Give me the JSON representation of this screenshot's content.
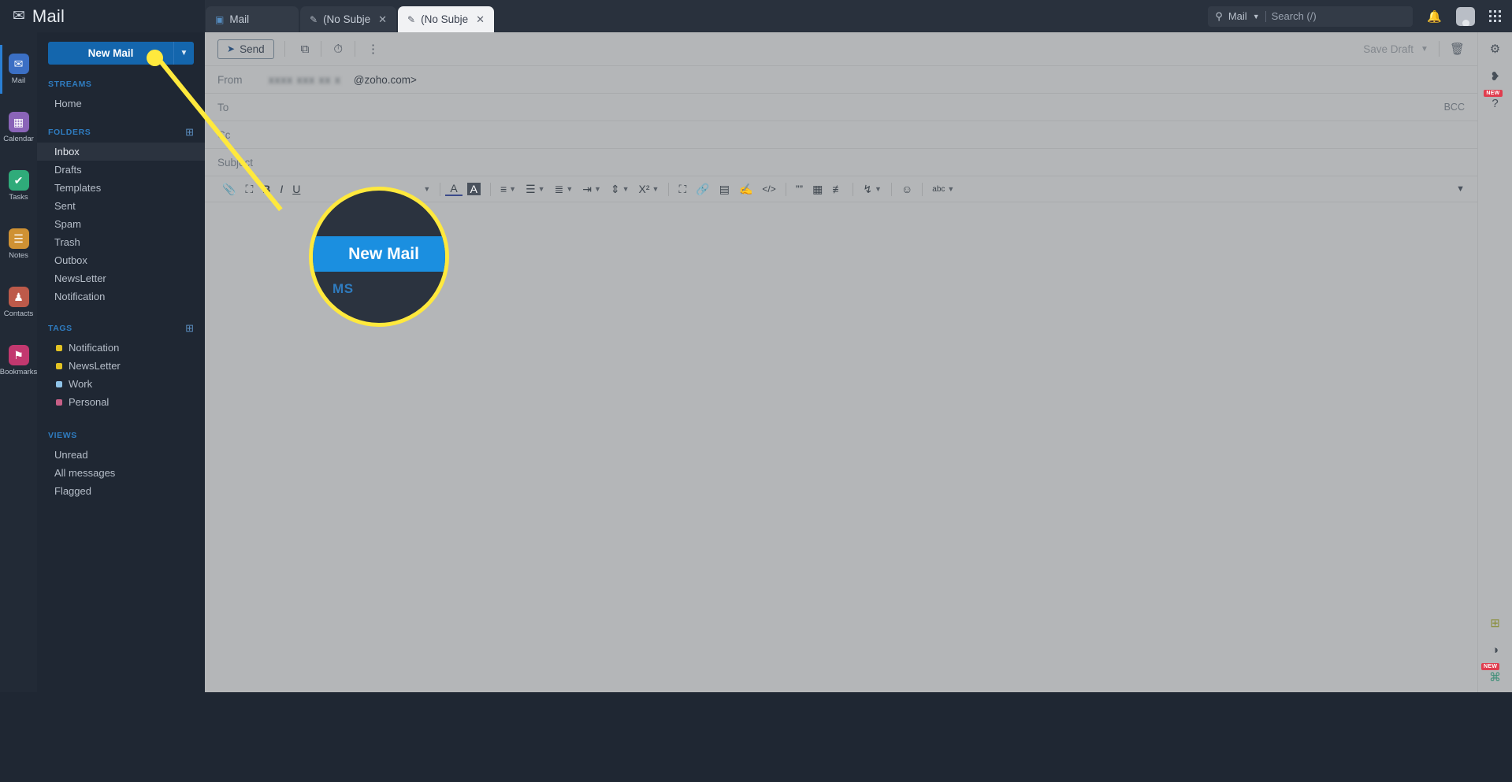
{
  "brand": {
    "label": "Mail",
    "icon": "envelope-icon"
  },
  "tabs": [
    {
      "label": "Mail",
      "icon": "mail-tab-icon",
      "active": false,
      "closable": false
    },
    {
      "label": "(No Subje",
      "icon": "pencil-icon",
      "active": false,
      "closable": true
    },
    {
      "label": "(No Subje",
      "icon": "pencil-icon",
      "active": true,
      "closable": true
    }
  ],
  "topright": {
    "search_scope": "Mail",
    "search_placeholder": "Search (/)",
    "search_icon": "search-icon",
    "chevron_icon": "chevron-down-icon",
    "bell_icon": "bell-icon",
    "avatar_icon": "avatar",
    "apps_icon": "grid-apps-icon"
  },
  "rail": [
    {
      "label": "Mail",
      "icon": "mail-icon",
      "color": "#3b6fc4",
      "glyph": "✉",
      "selected": true
    },
    {
      "label": "Calendar",
      "icon": "calendar-icon",
      "color": "#8a64b8",
      "glyph": "▦",
      "selected": false
    },
    {
      "label": "Tasks",
      "icon": "tasks-icon",
      "color": "#2fab7a",
      "glyph": "✔",
      "selected": false
    },
    {
      "label": "Notes",
      "icon": "notes-icon",
      "color": "#cf9133",
      "glyph": "☰",
      "selected": false
    },
    {
      "label": "Contacts",
      "icon": "contacts-icon",
      "color": "#bd5a4a",
      "glyph": "♟",
      "selected": false
    },
    {
      "label": "Bookmarks",
      "icon": "bookmarks-icon",
      "color": "#c2386f",
      "glyph": "⚑",
      "selected": false
    }
  ],
  "sidebar": {
    "new_mail_label": "New Mail",
    "new_mail_caret": "chevron-down-icon",
    "sections": [
      {
        "title": "STREAMS",
        "has_add": false,
        "items": [
          {
            "label": "Home",
            "selected": false
          }
        ]
      },
      {
        "title": "FOLDERS",
        "has_add": true,
        "items": [
          {
            "label": "Inbox",
            "selected": true
          },
          {
            "label": "Drafts",
            "selected": false
          },
          {
            "label": "Templates",
            "selected": false
          },
          {
            "label": "Sent",
            "selected": false
          },
          {
            "label": "Spam",
            "selected": false
          },
          {
            "label": "Trash",
            "selected": false
          },
          {
            "label": "Outbox",
            "selected": false
          },
          {
            "label": "NewsLetter",
            "selected": false
          },
          {
            "label": "Notification",
            "selected": false
          }
        ]
      },
      {
        "title": "TAGS",
        "has_add": true,
        "tags": [
          {
            "label": "Notification",
            "color": "#e3c323"
          },
          {
            "label": "NewsLetter",
            "color": "#e3c323"
          },
          {
            "label": "Work",
            "color": "#8fc3e8"
          },
          {
            "label": "Personal",
            "color": "#c75f86"
          }
        ]
      },
      {
        "title": "VIEWS",
        "has_add": false,
        "items": [
          {
            "label": "Unread",
            "selected": false
          },
          {
            "label": "All messages",
            "selected": false
          },
          {
            "label": "Flagged",
            "selected": false
          }
        ]
      }
    ]
  },
  "compose": {
    "send_label": "Send",
    "send_icon": "paper-plane-icon",
    "toolbar_icons": [
      {
        "name": "schedule-send-icon",
        "glyph": "⧉"
      },
      {
        "name": "reminder-clock-icon",
        "glyph": "⏱"
      },
      {
        "name": "more-options-icon",
        "glyph": "⋮"
      }
    ],
    "save_draft_label": "Save Draft",
    "save_draft_caret": "chevron-down-icon",
    "delete_icon": "trash-icon",
    "fields": [
      {
        "label": "From",
        "value_redacted": "xxxx xxx xx x",
        "value_suffix": "@zoho.com>"
      },
      {
        "label": "To",
        "value": "",
        "bcc_label": "BCC"
      },
      {
        "label": "Cc",
        "value": ""
      }
    ],
    "subject_placeholder": "Subject",
    "format_toolbar": [
      {
        "name": "attach-icon",
        "glyph": "📎",
        "caret": false
      },
      {
        "name": "insert-image-icon",
        "glyph": "⛰",
        "caret": false
      },
      {
        "name": "bold-icon",
        "glyph": "B",
        "caret": false
      },
      {
        "name": "italic-icon",
        "glyph": "I",
        "caret": false
      },
      {
        "name": "underline-icon",
        "glyph": "U",
        "caret": false
      },
      {
        "name": "font-family-icon",
        "glyph": "",
        "caret": true
      },
      {
        "name": "text-color-icon",
        "glyph": "A",
        "caret": false
      },
      {
        "name": "highlight-color-icon",
        "glyph": "A",
        "caret": false
      },
      {
        "name": "align-icon",
        "glyph": "≡",
        "caret": true
      },
      {
        "name": "bullet-list-icon",
        "glyph": "☰",
        "caret": true
      },
      {
        "name": "numbered-list-icon",
        "glyph": "≣",
        "caret": true
      },
      {
        "name": "indent-icon",
        "glyph": "⇥",
        "caret": true
      },
      {
        "name": "line-height-icon",
        "glyph": "⇕",
        "caret": true
      },
      {
        "name": "superscript-icon",
        "glyph": "X²",
        "caret": true
      },
      {
        "name": "image-icon",
        "glyph": "⛰",
        "caret": false
      },
      {
        "name": "link-icon",
        "glyph": "🔗",
        "caret": false
      },
      {
        "name": "insert-table-icon",
        "glyph": "▤",
        "caret": false
      },
      {
        "name": "signature-icon",
        "glyph": "✍",
        "caret": false
      },
      {
        "name": "code-icon",
        "glyph": "</>",
        "caret": false
      },
      {
        "name": "quote-icon",
        "glyph": "❝",
        "caret": false
      },
      {
        "name": "table-grid-icon",
        "glyph": "▦",
        "caret": false
      },
      {
        "name": "clear-format-icon",
        "glyph": "≢",
        "caret": false
      },
      {
        "name": "text-direction-icon",
        "glyph": "↕",
        "caret": true
      },
      {
        "name": "emoji-icon",
        "glyph": "☺",
        "caret": false
      },
      {
        "name": "spellcheck-icon",
        "glyph": "abc",
        "caret": true
      }
    ],
    "collapse_icon": "chevron-down-icon",
    "body_value": ""
  },
  "right_rail": [
    {
      "name": "settings-gear-icon",
      "glyph": "⚙",
      "badge": ""
    },
    {
      "name": "zoho-apps-icon",
      "glyph": "❥",
      "badge": ""
    },
    {
      "name": "help-icon",
      "glyph": "?",
      "badge": "NEW"
    },
    {
      "name": "add-widget-icon",
      "glyph": "⊞",
      "badge": ""
    },
    {
      "name": "theme-toggle-icon",
      "glyph": "◑",
      "badge": ""
    },
    {
      "name": "extensions-icon",
      "glyph": "⌘",
      "badge": "NEW"
    }
  ],
  "callout": {
    "highlight_color": "#ffe93d",
    "magnified_button_label": "New Mail",
    "magnified_section_label": "MS"
  }
}
